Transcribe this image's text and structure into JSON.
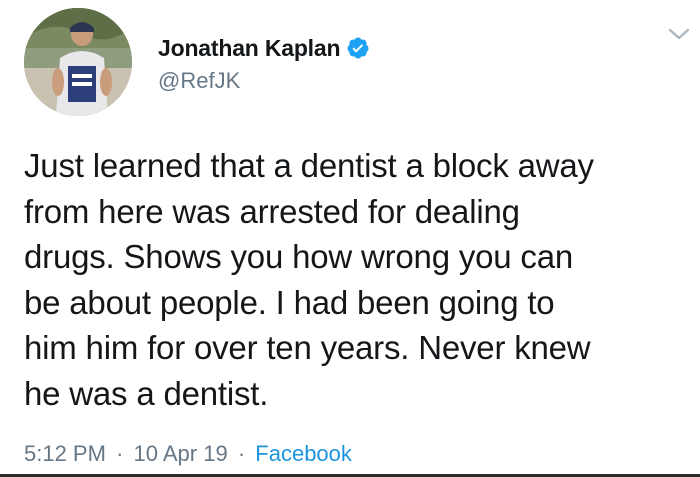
{
  "author": {
    "display_name": "Jonathan Kaplan",
    "handle": "@RefJK",
    "verified_icon": "verified-badge-icon",
    "verified_color": "#1da1f2"
  },
  "tweet": {
    "lines": [
      "Just learned that a dentist a block away",
      "from here was arrested for dealing",
      "drugs. Shows you how wrong you can",
      "be about people. I had been going to",
      "him him for over ten years. Never knew",
      "he was a dentist."
    ]
  },
  "meta": {
    "time": "5:12 PM",
    "separator": "·",
    "date": "10 Apr 19",
    "source": "Facebook"
  },
  "icons": {
    "menu": "chevron-down-icon"
  },
  "colors": {
    "text": "#14171a",
    "secondary": "#657786",
    "link": "#1b95e0"
  }
}
